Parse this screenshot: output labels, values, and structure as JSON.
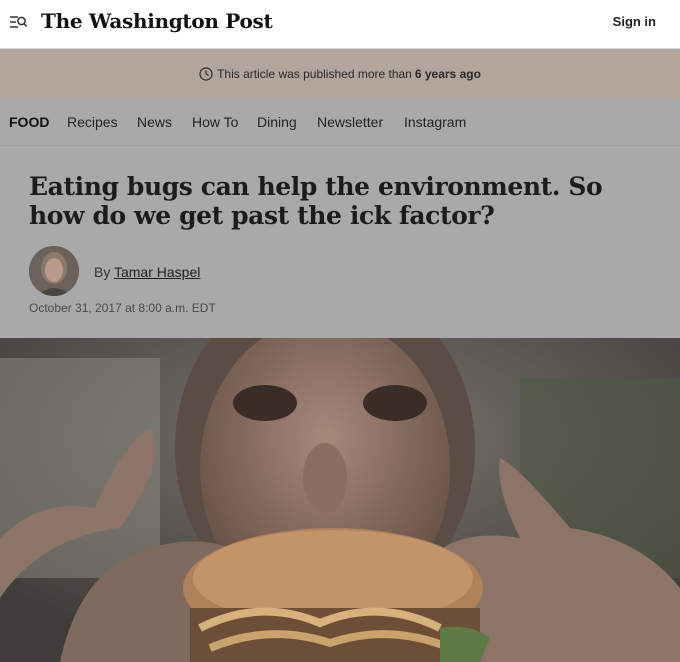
{
  "header": {
    "logo_text": "The Washington Post",
    "signin_label": "Sign in",
    "menu_icon": "menu-search-icon"
  },
  "banner": {
    "prefix": "This article was published more than",
    "age": "6 years ago",
    "icon": "clock-icon",
    "color": "#b1a59c"
  },
  "nav": {
    "section": "FOOD",
    "items": [
      "Recipes",
      "News",
      "How To",
      "Dining",
      "Newsletter",
      "Instagram"
    ]
  },
  "article": {
    "headline": "Eating bugs can help the environment. So how do we get past the ick factor?",
    "by_prefix": "By",
    "author": "Tamar Haspel",
    "date": "October 31, 2017 at 8:00 a.m. EDT"
  },
  "hero": {
    "image": "person-holding-mealworm-burger-photo"
  }
}
